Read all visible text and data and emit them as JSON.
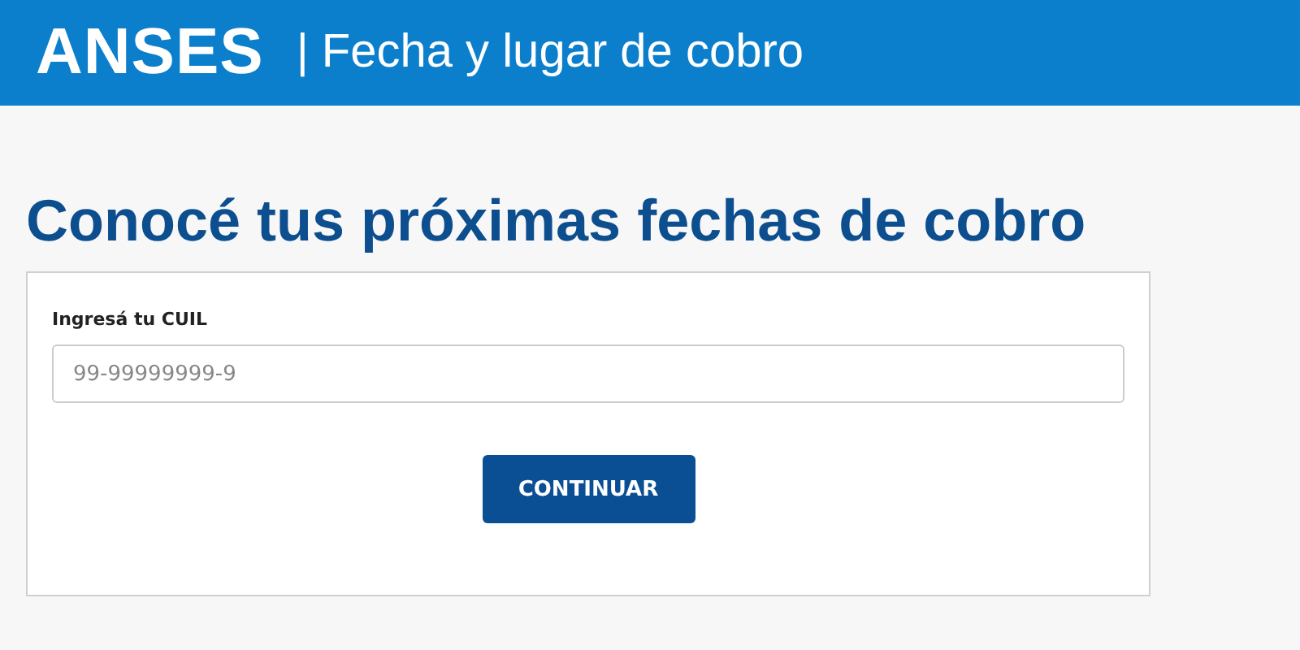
{
  "header": {
    "logo": "ANSES",
    "title": "| Fecha y lugar de cobro"
  },
  "heading": "Conocé tus próximas fechas de cobro",
  "form": {
    "label": "Ingresá tu CUIL",
    "placeholder": "99-99999999-9",
    "button": "CONTINUAR"
  }
}
